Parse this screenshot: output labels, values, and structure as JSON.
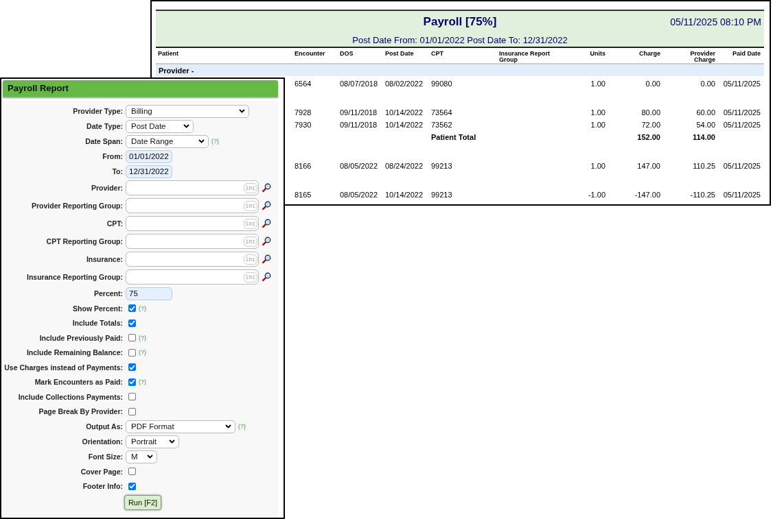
{
  "report": {
    "title": "Payroll [75%]",
    "timestamp": "05/11/2025 08:10 PM",
    "subtitle": "Post Date From: 01/01/2022 Post Date To: 12/31/2022",
    "columns": [
      {
        "label": "Patient"
      },
      {
        "label": "Encounter"
      },
      {
        "label": "DOS"
      },
      {
        "label": "Post Date"
      },
      {
        "label": "CPT"
      },
      {
        "label": "Insurance Report Group"
      },
      {
        "label": "Units"
      },
      {
        "label": "Charge"
      },
      {
        "label": "Provider Charge"
      },
      {
        "label": "Paid Date"
      }
    ],
    "group": "Provider -",
    "rows": [
      {
        "kind": "line",
        "cells": [
          "",
          "6564",
          "08/07/2018",
          "08/02/2022",
          "99080",
          "",
          "1.00",
          "0.00",
          "0.00",
          "05/11/2025"
        ]
      },
      {
        "kind": "gap"
      },
      {
        "kind": "line",
        "cells": [
          "",
          "7928",
          "09/11/2018",
          "10/14/2022",
          "73564",
          "",
          "1.00",
          "80.00",
          "60.00",
          "05/11/2025"
        ]
      },
      {
        "kind": "line",
        "cells": [
          "",
          "7930",
          "09/11/2018",
          "10/14/2022",
          "73562",
          "",
          "1.00",
          "72.00",
          "54.00",
          "05/11/2025"
        ]
      },
      {
        "kind": "total",
        "label": "Patient Total",
        "cells": [
          "",
          "",
          "",
          "",
          "",
          "",
          "",
          "152.00",
          "114.00",
          ""
        ]
      },
      {
        "kind": "gap"
      },
      {
        "kind": "line",
        "cells": [
          "",
          "8166",
          "08/05/2022",
          "08/24/2022",
          "99213",
          "",
          "1.00",
          "147.00",
          "110.25",
          "05/11/2025"
        ]
      },
      {
        "kind": "gap"
      },
      {
        "kind": "line",
        "cells": [
          "",
          "8165",
          "08/05/2022",
          "10/14/2022",
          "99213",
          "",
          "-1.00",
          "-147.00",
          "-110.25",
          "05/11/2025"
        ]
      }
    ]
  },
  "form": {
    "title": "Payroll Report",
    "fields": [
      {
        "kind": "select",
        "label": "Provider Type:",
        "value": "Billing"
      },
      {
        "kind": "select",
        "label": "Date Type:",
        "value": "Post Date"
      },
      {
        "kind": "select",
        "label": "Date Span:",
        "value": "Date Range",
        "help": "(?)"
      },
      {
        "kind": "date",
        "label": "From:",
        "value": "01/01/2022"
      },
      {
        "kind": "date",
        "label": "To:",
        "value": "12/31/2022"
      },
      {
        "kind": "lookup",
        "label": "Provider:",
        "badge": "inc"
      },
      {
        "kind": "lookup",
        "label": "Provider Reporting Group:",
        "badge": "inc"
      },
      {
        "kind": "lookup",
        "label": "CPT:",
        "badge": "inc"
      },
      {
        "kind": "lookup",
        "label": "CPT Reporting Group:",
        "badge": "inc"
      },
      {
        "kind": "lookup",
        "label": "Insurance:",
        "badge": "inc"
      },
      {
        "kind": "lookup",
        "label": "Insurance Reporting Group:",
        "badge": "inc"
      },
      {
        "kind": "date",
        "label": "Percent:",
        "value": "75"
      },
      {
        "kind": "checkbox",
        "label": "Show Percent:",
        "checked": true,
        "help": "(?)"
      },
      {
        "kind": "checkbox",
        "label": "Include Totals:",
        "checked": true
      },
      {
        "kind": "checkbox",
        "label": "Include Previously Paid:",
        "checked": false,
        "help": "(?)"
      },
      {
        "kind": "checkbox",
        "label": "Include Remaining Balance:",
        "checked": false,
        "help": "(?)"
      },
      {
        "kind": "checkbox",
        "label": "Use Charges instead of Payments:",
        "checked": true
      },
      {
        "kind": "checkbox",
        "label": "Mark Encounters as Paid:",
        "checked": true,
        "help": "(?)"
      },
      {
        "kind": "checkbox",
        "label": "Include Collections Payments:",
        "checked": false
      },
      {
        "kind": "checkbox",
        "label": "Page Break By Provider:",
        "checked": false
      },
      {
        "kind": "select",
        "label": "Output As:",
        "value": "PDF Format",
        "help": "(?)"
      },
      {
        "kind": "select",
        "label": "Orientation:",
        "value": "Portrait"
      },
      {
        "kind": "select",
        "label": "Font Size:",
        "value": "M"
      },
      {
        "kind": "checkbox",
        "label": "Cover Page:",
        "checked": false
      },
      {
        "kind": "checkbox",
        "label": "Footer Info:",
        "checked": true
      }
    ],
    "run_button": "Run [F2]"
  }
}
